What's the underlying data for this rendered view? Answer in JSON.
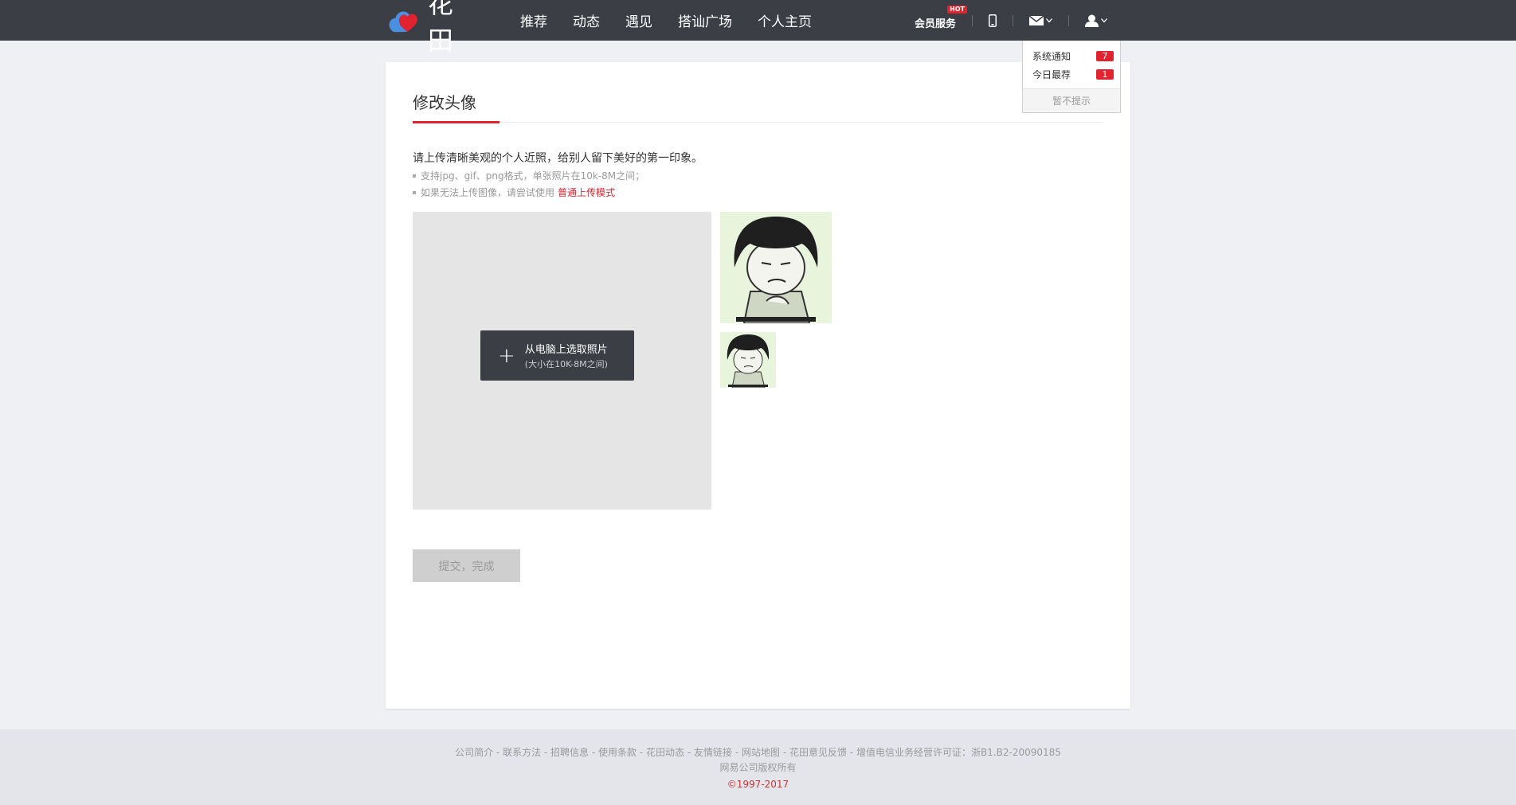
{
  "header": {
    "logo_text": "花田",
    "nav": [
      "推荐",
      "动态",
      "遇见",
      "搭讪广场",
      "个人主页"
    ],
    "vip_label": "会员服务",
    "vip_badge": "HOT",
    "icons": [
      "phone-icon",
      "mail-icon",
      "user-icon"
    ]
  },
  "notifications": {
    "items": [
      {
        "label": "系统通知",
        "count": "7"
      },
      {
        "label": "今日最荐",
        "count": "1"
      }
    ],
    "dismiss_label": "暂不提示"
  },
  "page": {
    "title": "修改头像",
    "intro": "请上传清晰美观的个人近照，给别人留下美好的第一印象。",
    "tip1": "支持jpg、gif、png格式，单张照片在10k-8M之间；",
    "tip2_prefix": "如果无法上传图像，请尝试使用",
    "tip2_link": "普通上传模式",
    "upload_button": "从电脑上选取照片",
    "upload_hint": "(大小在10K-8M之间)",
    "submit_label": "提交，完成"
  },
  "footer": {
    "links": [
      "公司简介",
      "联系方法",
      "招聘信息",
      "使用条款",
      "花田动态",
      "友情链接",
      "网站地图",
      "花田意见反馈"
    ],
    "license": "增值电信业务经营许可证：浙B1.B2-20090185",
    "owner": "网易公司版权所有",
    "copyright": "©1997-2017"
  },
  "colors": {
    "topbar": "#3b3e45",
    "accent_red": "#e0232e",
    "background": "#eef0f4"
  }
}
